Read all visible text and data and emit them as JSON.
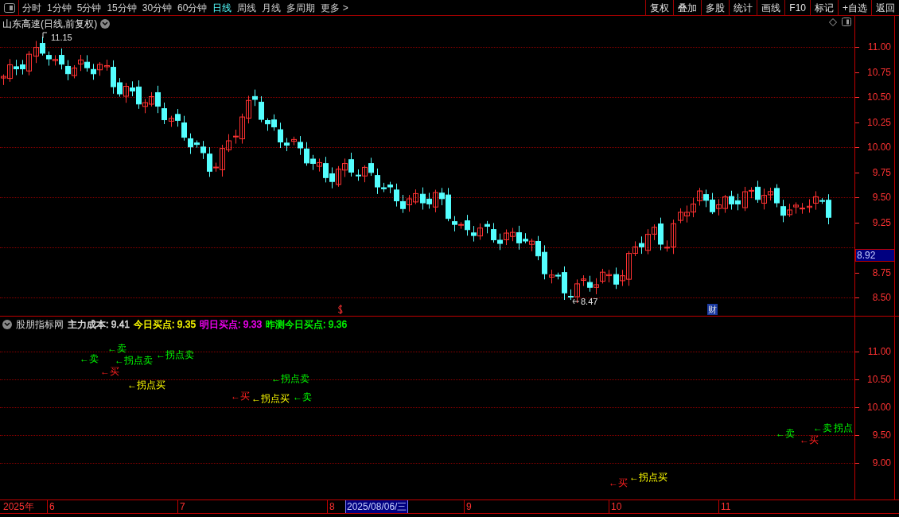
{
  "toolbar": {
    "periods": [
      {
        "label": "分时",
        "selected": false
      },
      {
        "label": "1分钟",
        "selected": false
      },
      {
        "label": "5分钟",
        "selected": false
      },
      {
        "label": "15分钟",
        "selected": false
      },
      {
        "label": "30分钟",
        "selected": false
      },
      {
        "label": "60分钟",
        "selected": false
      },
      {
        "label": "日线",
        "selected": true
      },
      {
        "label": "周线",
        "selected": false
      },
      {
        "label": "月线",
        "selected": false
      },
      {
        "label": "多周期",
        "selected": false
      },
      {
        "label": "更多 >",
        "selected": false
      }
    ],
    "buttons": [
      "复权",
      "叠加",
      "多股",
      "统计",
      "画线",
      "F10",
      "标记",
      "+自选",
      "返回"
    ]
  },
  "chart": {
    "title": "山东高速(日线,前复权)",
    "high_marker": "11.15",
    "low_marker": "8.47",
    "price_axis": [
      "11.00",
      "10.75",
      "10.50",
      "10.25",
      "10.00",
      "9.75",
      "9.50",
      "9.25",
      "8.75",
      "8.50"
    ],
    "current_price": "8.92",
    "badge": "财"
  },
  "indicator": {
    "name": "股朋指标网",
    "readouts": [
      {
        "label": "主力成本: 9.41",
        "color": "#e0e0e0"
      },
      {
        "label": "今日买点: 9.35",
        "color": "#ffff00"
      },
      {
        "label": "明日买点: 9.33",
        "color": "#ff00ff"
      },
      {
        "label": "昨测今日买点: 9.36",
        "color": "#00ff00"
      }
    ],
    "axis": [
      "11.00",
      "10.50",
      "10.00",
      "9.50",
      "9.00"
    ],
    "signals": [
      {
        "text": "←卖",
        "kind": "sell"
      },
      {
        "text": "←卖",
        "kind": "sell"
      },
      {
        "text": "←拐点卖",
        "kind": "pivot_sell"
      },
      {
        "text": "←拐点卖",
        "kind": "pivot_sell"
      },
      {
        "text": "←买",
        "kind": "buy"
      },
      {
        "text": "←拐点买",
        "kind": "pivot_buy"
      },
      {
        "text": "←拐点卖",
        "kind": "pivot_sell"
      },
      {
        "text": "←买",
        "kind": "buy"
      },
      {
        "text": "←拐点买",
        "kind": "pivot_buy"
      },
      {
        "text": "←卖",
        "kind": "sell"
      },
      {
        "text": "←卖",
        "kind": "sell"
      },
      {
        "text": "←买",
        "kind": "buy"
      },
      {
        "text": "←卖",
        "kind": "sell"
      },
      {
        "text": "拐点",
        "kind": "pivot_sell"
      },
      {
        "text": "←买",
        "kind": "buy"
      },
      {
        "text": "←拐点买",
        "kind": "pivot_buy"
      }
    ]
  },
  "date_axis": {
    "year": "2025年",
    "months": [
      "6",
      "7",
      "8",
      "9",
      "10",
      "11"
    ],
    "cursor_date": "2025/08/06/三"
  }
}
